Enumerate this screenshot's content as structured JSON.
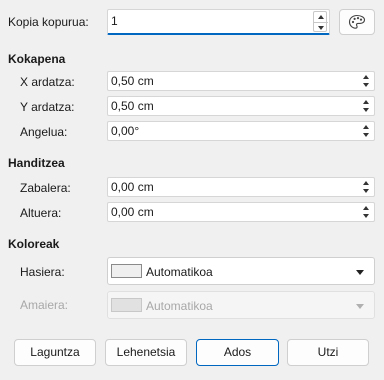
{
  "copies": {
    "label": "Kopia kopurua:",
    "value": "1"
  },
  "sections": {
    "placement": "Kokapena",
    "enlargement": "Handitzea",
    "colors": "Koloreak"
  },
  "placement": {
    "x": {
      "label": "X ardatza:",
      "value": "0,50 cm"
    },
    "y": {
      "label": "Y ardatza:",
      "value": "0,50 cm"
    },
    "angle": {
      "label": "Angelua:",
      "value": "0,00°"
    }
  },
  "enlargement": {
    "width": {
      "label": "Zabalera:",
      "value": "0,00 cm"
    },
    "height": {
      "label": "Altuera:",
      "value": "0,00 cm"
    }
  },
  "colors": {
    "start": {
      "label": "Hasiera:",
      "value": "Automatikoa"
    },
    "end": {
      "label": "Amaiera:",
      "value": "Automatikoa"
    }
  },
  "buttons": {
    "help": "Laguntza",
    "defaults": "Lehenetsia",
    "ok": "Ados",
    "cancel": "Utzi"
  },
  "icons": {
    "values_from_selection": "palette-icon"
  },
  "accent_color": "#0067c0"
}
